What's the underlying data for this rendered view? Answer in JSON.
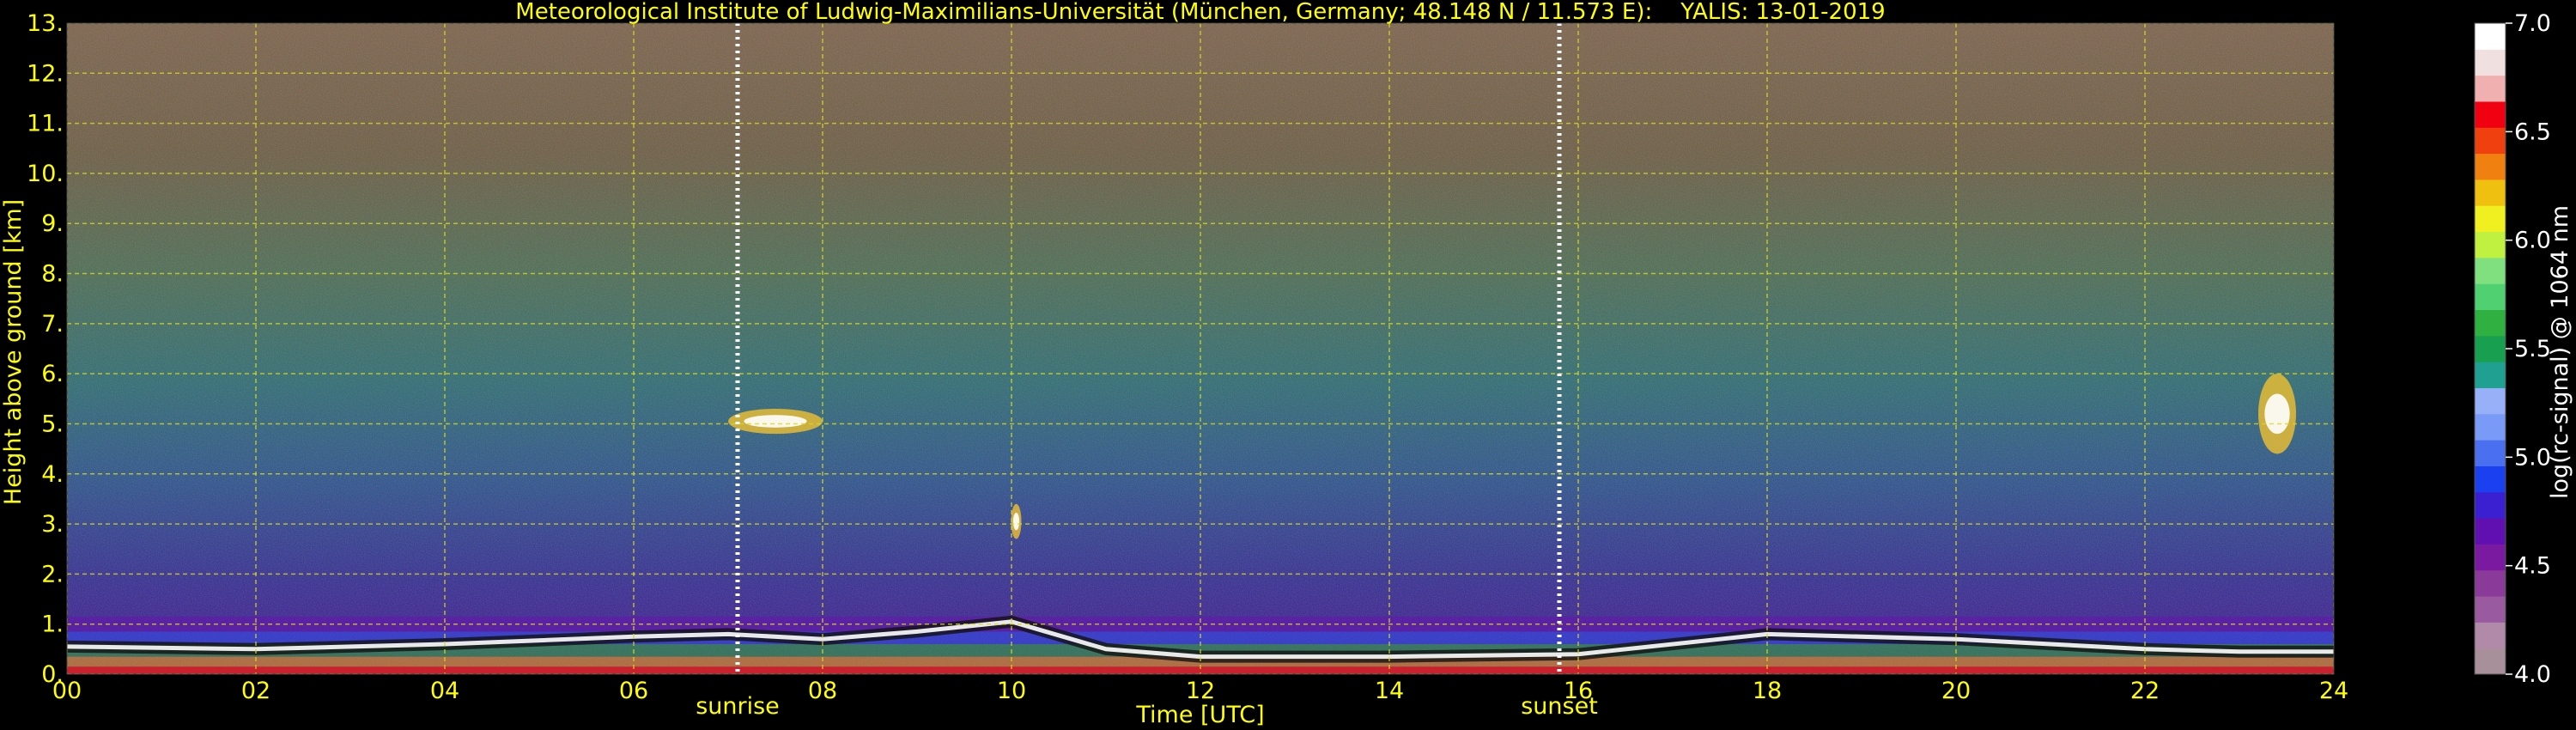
{
  "chart_data": {
    "type": "heatmap",
    "title": "Meteorological Institute of Ludwig-Maximilians-Universität (München, Germany; 48.148 N / 11.573 E):    YALIS: 13-01-2019",
    "xlabel": "Time [UTC]",
    "ylabel": "Height above ground [km]",
    "xlim": [
      0,
      24
    ],
    "ylim": [
      0,
      13
    ],
    "x_ticks": [
      "00",
      "02",
      "04",
      "06",
      "08",
      "10",
      "12",
      "14",
      "16",
      "18",
      "20",
      "22",
      "24"
    ],
    "y_ticks": [
      "0.",
      "1.",
      "2.",
      "3.",
      "4.",
      "5.",
      "6.",
      "7.",
      "8.",
      "9.",
      "10.",
      "11.",
      "12.",
      "13."
    ],
    "grid": true,
    "markers": [
      {
        "label": "sunrise",
        "x": 7.1
      },
      {
        "label": "sunset",
        "x": 15.8
      }
    ],
    "colorbar": {
      "label": "log(rc-signal) @ 1064 nm",
      "range": [
        4.0,
        7.0
      ],
      "ticks": [
        "4.0",
        "4.5",
        "5.0",
        "5.5",
        "6.0",
        "6.5",
        "7.0"
      ],
      "colors": [
        "#a8909a",
        "#b08aa8",
        "#9a5aa0",
        "#8a3a98",
        "#7a1aa0",
        "#6010b0",
        "#3a20d0",
        "#1a40f0",
        "#4a70f0",
        "#7a9af8",
        "#98b0f8",
        "#20a090",
        "#18a050",
        "#30b040",
        "#50d070",
        "#80e080",
        "#c0f040",
        "#f0f020",
        "#f0c010",
        "#f08010",
        "#f04010",
        "#f00010",
        "#f0b0b0",
        "#f0e0e0",
        "#ffffff"
      ]
    },
    "features": [
      {
        "name": "boundary layer aerosol",
        "x_range": [
          0,
          24
        ],
        "height_km": [
          0,
          1.1
        ]
      },
      {
        "name": "cloud",
        "x_range": [
          7.0,
          8.0
        ],
        "height_km": [
          4.8,
          5.3
        ]
      },
      {
        "name": "cloud",
        "x_range": [
          10.0,
          10.1
        ],
        "height_km": [
          2.7,
          3.4
        ]
      },
      {
        "name": "cloud",
        "x_range": [
          23.2,
          23.6
        ],
        "height_km": [
          4.4,
          6.0
        ]
      }
    ]
  }
}
